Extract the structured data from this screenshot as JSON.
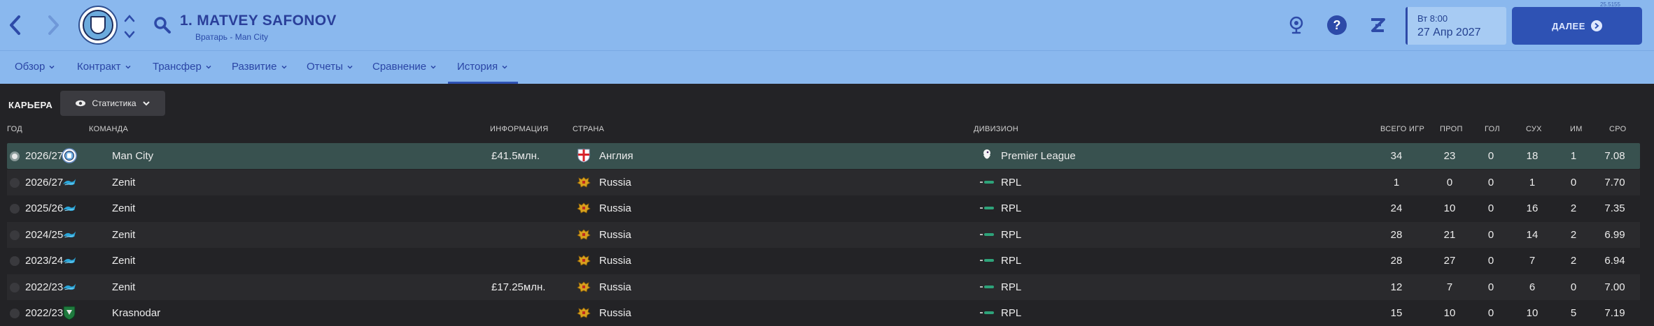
{
  "header": {
    "player_name": "1. MATVEY SAFONOV",
    "player_sub": "Вратарь - Man City",
    "date_day": "Вт 8:00",
    "date_full": "27 Апр 2027",
    "continue_label": "ДАЛЕЕ",
    "corner_text": "25.5155"
  },
  "tabs": [
    {
      "label": "Обзор"
    },
    {
      "label": "Контракт"
    },
    {
      "label": "Трансфер"
    },
    {
      "label": "Развитие"
    },
    {
      "label": "Отчеты"
    },
    {
      "label": "Сравнение"
    },
    {
      "label": "История",
      "active": true
    }
  ],
  "section": {
    "title": "КАРЬЕРА",
    "view_label": "Статистика"
  },
  "columns": {
    "year": "ГОД",
    "team": "КОМАНДА",
    "info": "ИНФОРМАЦИЯ",
    "country": "СТРАНА",
    "division": "ДИВИЗИОН",
    "apps": "ВСЕГО ИГР",
    "conceded": "ПРОП",
    "goals": "ГОЛ",
    "clean": "СУХ",
    "pom": "ИМ",
    "rating": "СРО"
  },
  "rows": [
    {
      "year": "2026/27",
      "team": "Man City",
      "team_icon": "man-city-crest-icon",
      "info": "£41.5млн.",
      "country": "Англия",
      "country_icon": "england-flag-icon",
      "division": "Premier League",
      "division_icon": "premier-league-icon",
      "apps": "34",
      "conceded": "23",
      "goals": "0",
      "clean": "18",
      "pom": "1",
      "rating": "7.08",
      "selected": true
    },
    {
      "year": "2026/27",
      "team": "Zenit",
      "team_icon": "zenit-crest-icon",
      "info": "",
      "country": "Russia",
      "country_icon": "russia-emblem-icon",
      "division": "RPL",
      "division_icon": "rpl-icon",
      "apps": "1",
      "conceded": "0",
      "goals": "0",
      "clean": "1",
      "pom": "0",
      "rating": "7.70"
    },
    {
      "year": "2025/26",
      "team": "Zenit",
      "team_icon": "zenit-crest-icon",
      "info": "",
      "country": "Russia",
      "country_icon": "russia-emblem-icon",
      "division": "RPL",
      "division_icon": "rpl-icon",
      "apps": "24",
      "conceded": "10",
      "goals": "0",
      "clean": "16",
      "pom": "2",
      "rating": "7.35"
    },
    {
      "year": "2024/25",
      "team": "Zenit",
      "team_icon": "zenit-crest-icon",
      "info": "",
      "country": "Russia",
      "country_icon": "russia-emblem-icon",
      "division": "RPL",
      "division_icon": "rpl-icon",
      "apps": "28",
      "conceded": "21",
      "goals": "0",
      "clean": "14",
      "pom": "2",
      "rating": "6.99"
    },
    {
      "year": "2023/24",
      "team": "Zenit",
      "team_icon": "zenit-crest-icon",
      "info": "",
      "country": "Russia",
      "country_icon": "russia-emblem-icon",
      "division": "RPL",
      "division_icon": "rpl-icon",
      "apps": "28",
      "conceded": "27",
      "goals": "0",
      "clean": "7",
      "pom": "2",
      "rating": "6.94"
    },
    {
      "year": "2022/23",
      "team": "Zenit",
      "team_icon": "zenit-crest-icon",
      "info": "£17.25млн.",
      "country": "Russia",
      "country_icon": "russia-emblem-icon",
      "division": "RPL",
      "division_icon": "rpl-icon",
      "apps": "12",
      "conceded": "7",
      "goals": "0",
      "clean": "6",
      "pom": "0",
      "rating": "7.00"
    },
    {
      "year": "2022/23",
      "team": "Krasnodar",
      "team_icon": "krasnodar-crest-icon",
      "info": "",
      "country": "Russia",
      "country_icon": "russia-emblem-icon",
      "division": "RPL",
      "division_icon": "rpl-icon",
      "apps": "15",
      "conceded": "10",
      "goals": "0",
      "clean": "10",
      "pom": "5",
      "rating": "7.19"
    }
  ],
  "colors": {
    "header_bg": "#8ab8ee",
    "accent": "#2e52b4",
    "content_bg": "#232326",
    "selected_row": "#38514f"
  }
}
